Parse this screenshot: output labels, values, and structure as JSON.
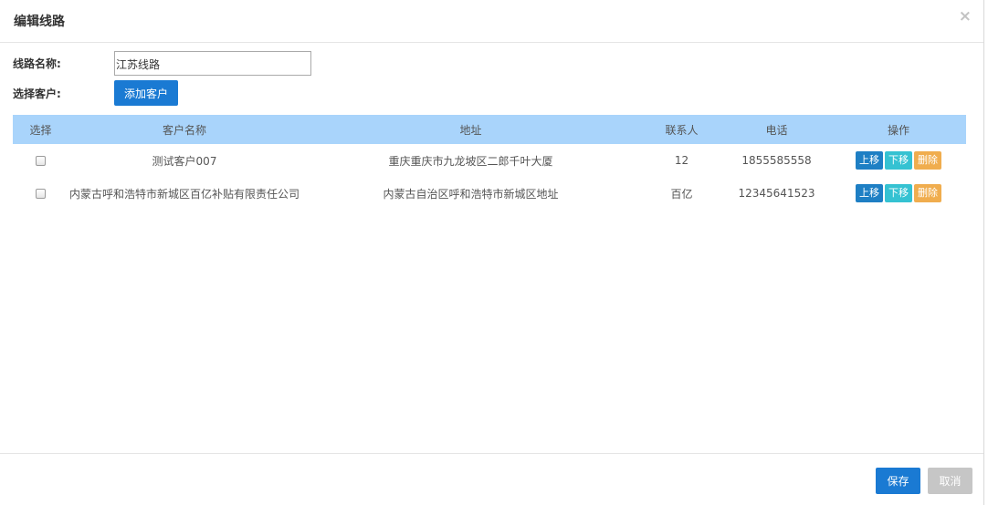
{
  "modal": {
    "title": "编辑线路",
    "close_glyph": "×"
  },
  "form": {
    "route_name_label": "线路名称:",
    "route_name_value": "江苏线路",
    "select_customer_label": "选择客户:",
    "add_customer_button": "添加客户"
  },
  "table": {
    "headers": [
      "选择",
      "客户名称",
      "地址",
      "联系人",
      "电话",
      "操作"
    ],
    "rows": [
      {
        "customer_name": "测试客户007",
        "address": "重庆重庆市九龙坡区二郎千叶大厦",
        "contact": "12",
        "phone": "1855585558",
        "actions": {
          "up": "上移",
          "down": "下移",
          "delete": "删除"
        }
      },
      {
        "customer_name": "内蒙古呼和浩特市新城区百亿补贴有限责任公司",
        "address": "内蒙古自治区呼和浩特市新城区地址",
        "contact": "百亿",
        "phone": "12345641523",
        "actions": {
          "up": "上移",
          "down": "下移",
          "delete": "删除"
        }
      }
    ]
  },
  "footer": {
    "save_label": "保存",
    "cancel_label": "取消"
  },
  "colors": {
    "primary": "#1a7ad3",
    "header_bg": "#a9d4fb",
    "move_up": "#1e7fc4",
    "move_down": "#35c2d2",
    "delete": "#f0ad4e",
    "cancel": "#c6c6c6"
  },
  "icons": {
    "close": "close-icon",
    "checkbox": "checkbox"
  }
}
